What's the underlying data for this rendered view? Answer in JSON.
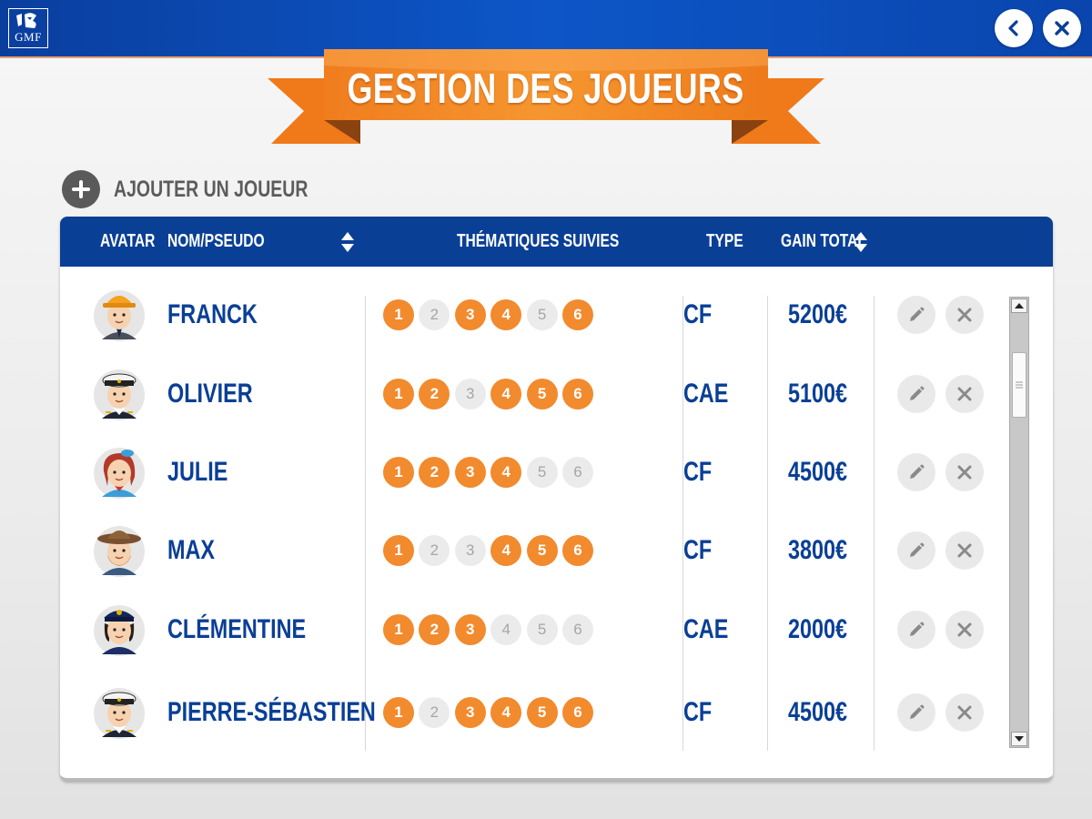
{
  "app": {
    "logo_text": "GMF",
    "title": "GESTION DES JOUEURS",
    "add_player_label": "AJOUTER UN JOUEUR"
  },
  "colors": {
    "primary_blue": "#0a3f96",
    "accent_orange": "#f28a2e",
    "inactive_gray": "#ebebeb"
  },
  "table": {
    "headers": {
      "avatar": "AVATAR",
      "name": "NOM/PSEUDO",
      "themes": "THÉMATIQUES SUIVIES",
      "type": "TYPE",
      "gain": "GAIN TOTAL"
    },
    "rows": [
      {
        "avatar_icon": "worker-hardhat-avatar",
        "name": "FRANCK",
        "themes_active": [
          true,
          false,
          true,
          true,
          false,
          true
        ],
        "type": "CF",
        "gain": "5200€"
      },
      {
        "avatar_icon": "pilot-avatar",
        "name": "OLIVIER",
        "themes_active": [
          true,
          true,
          false,
          true,
          true,
          true
        ],
        "type": "CAE",
        "gain": "5100€"
      },
      {
        "avatar_icon": "flight-attendant-avatar",
        "name": "JULIE",
        "themes_active": [
          true,
          true,
          true,
          true,
          false,
          false
        ],
        "type": "CF",
        "gain": "4500€"
      },
      {
        "avatar_icon": "explorer-avatar",
        "name": "MAX",
        "themes_active": [
          true,
          false,
          false,
          true,
          true,
          true
        ],
        "type": "CF",
        "gain": "3800€"
      },
      {
        "avatar_icon": "police-officer-avatar",
        "name": "CLÉMENTINE",
        "themes_active": [
          true,
          true,
          true,
          false,
          false,
          false
        ],
        "type": "CAE",
        "gain": "2000€"
      },
      {
        "avatar_icon": "pilot-avatar",
        "name": "PIERRE-SÉBASTIEN",
        "themes_active": [
          true,
          false,
          true,
          true,
          true,
          true
        ],
        "type": "CF",
        "gain": "4500€"
      }
    ],
    "theme_numbers": [
      "1",
      "2",
      "3",
      "4",
      "5",
      "6"
    ]
  },
  "icons": {
    "back": "chevron-left-icon",
    "close": "close-icon",
    "add": "plus-icon",
    "sort": "sort-arrows-icon",
    "edit": "pencil-icon",
    "delete": "close-icon"
  }
}
